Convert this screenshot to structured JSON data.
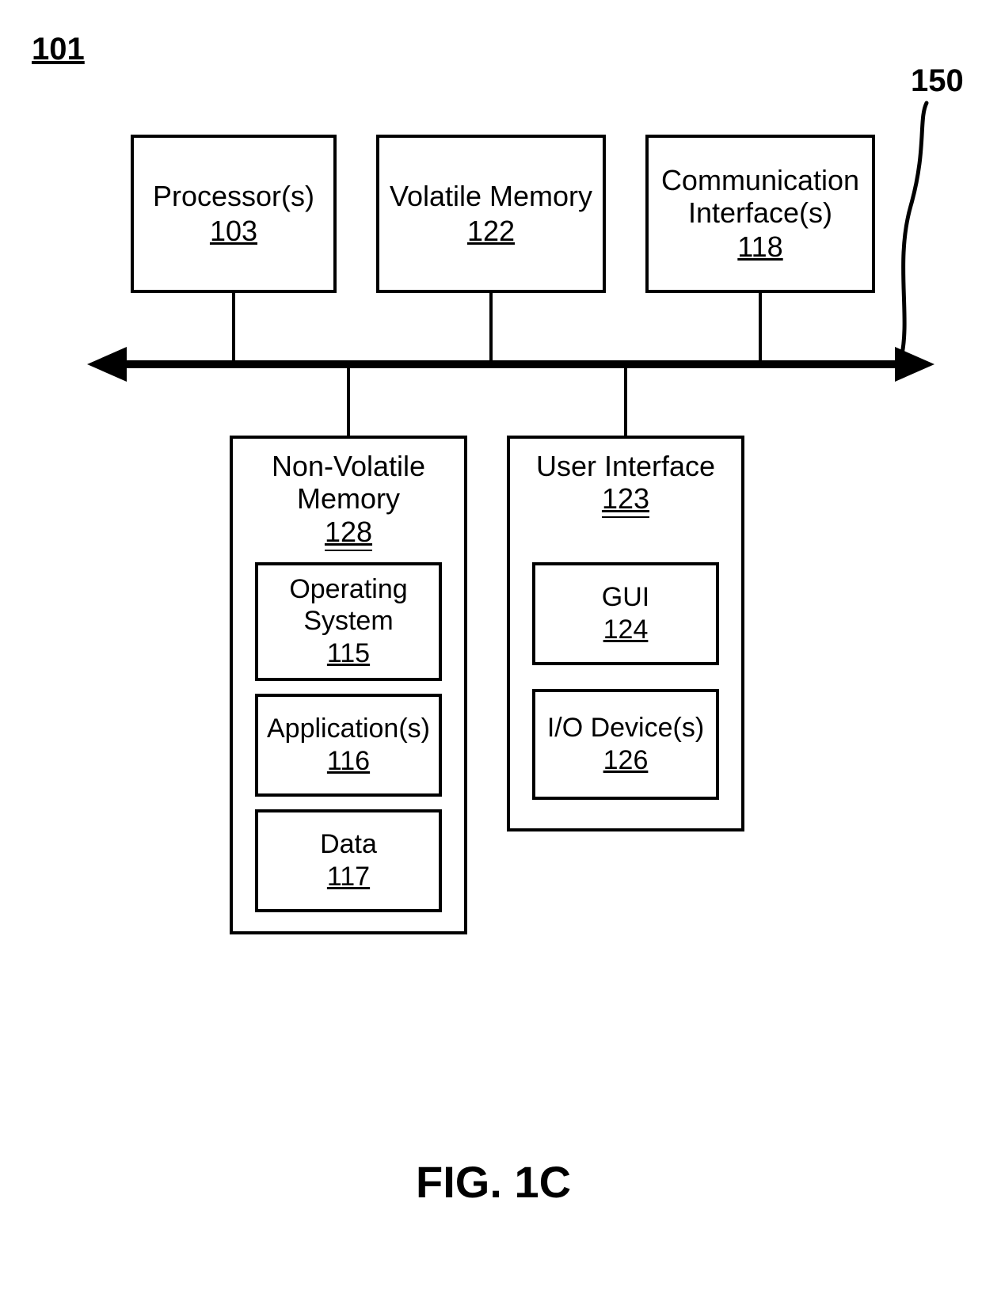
{
  "system_ref": "101",
  "bus_ref": "150",
  "figure_label": "FIG. 1C",
  "top": {
    "processor": {
      "label": "Processor(s)",
      "ref": "103"
    },
    "volatile": {
      "label": "Volatile Memory",
      "ref": "122"
    },
    "communication": {
      "label": "Communication Interface(s)",
      "ref": "118"
    }
  },
  "nonvolatile": {
    "title": "Non-Volatile Memory",
    "ref": "128",
    "os": {
      "label": "Operating System",
      "ref": "115"
    },
    "apps": {
      "label": "Application(s)",
      "ref": "116"
    },
    "data": {
      "label": "Data",
      "ref": "117"
    }
  },
  "userinterface": {
    "title": "User Interface",
    "ref": "123",
    "gui": {
      "label": "GUI",
      "ref": "124"
    },
    "io": {
      "label": "I/O Device(s)",
      "ref": "126"
    }
  }
}
